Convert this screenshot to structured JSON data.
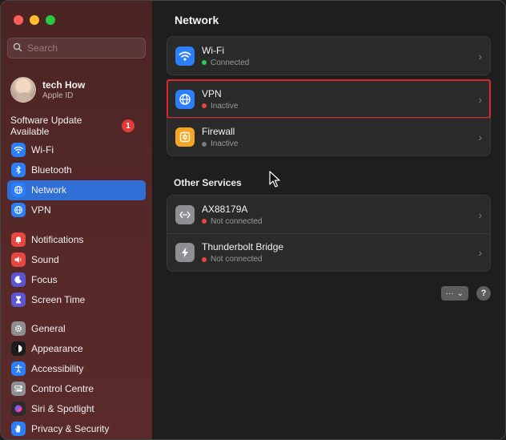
{
  "sidebar": {
    "search": {
      "placeholder": "Search"
    },
    "profile": {
      "name": "tech How",
      "subtitle": "Apple ID"
    },
    "update": {
      "label": "Software Update Available",
      "count": "1"
    },
    "groups": [
      [
        {
          "label": "Wi-Fi",
          "icon": "wifi-icon",
          "color": "#2d7ff9"
        },
        {
          "label": "Bluetooth",
          "icon": "bluetooth-icon",
          "color": "#2d7ff9"
        },
        {
          "label": "Network",
          "icon": "globe-icon",
          "color": "#2d7ff9",
          "active": true
        },
        {
          "label": "VPN",
          "icon": "globe-icon",
          "color": "#2d7ff9"
        }
      ],
      [
        {
          "label": "Notifications",
          "icon": "bell-icon",
          "color": "#e5483f"
        },
        {
          "label": "Sound",
          "icon": "speaker-icon",
          "color": "#e5483f"
        },
        {
          "label": "Focus",
          "icon": "moon-icon",
          "color": "#5c55d6"
        },
        {
          "label": "Screen Time",
          "icon": "hourglass-icon",
          "color": "#5c55d6"
        }
      ],
      [
        {
          "label": "General",
          "icon": "gear-icon",
          "color": "#8e8e93"
        },
        {
          "label": "Appearance",
          "icon": "appearance-icon",
          "color": "#1c1c1e"
        },
        {
          "label": "Accessibility",
          "icon": "accessibility-icon",
          "color": "#2d7ff9"
        },
        {
          "label": "Control Centre",
          "icon": "control-centre-icon",
          "color": "#8e8e93"
        },
        {
          "label": "Siri & Spotlight",
          "icon": "siri-icon",
          "color": "#2b2b2b"
        },
        {
          "label": "Privacy & Security",
          "icon": "hand-icon",
          "color": "#2d7ff9"
        }
      ]
    ]
  },
  "main": {
    "title": "Network",
    "services": [
      {
        "name": "Wi-Fi",
        "status": "Connected",
        "status_color": "#32c75a",
        "icon": "wifi-icon",
        "icon_color": "#2d7ff9"
      },
      {
        "name": "VPN",
        "status": "Inactive",
        "status_color": "#e5483f",
        "icon": "globe-icon",
        "icon_color": "#2d7ff9",
        "highlighted": true
      },
      {
        "name": "Firewall",
        "status": "Inactive",
        "status_color": "#7a7a7a",
        "icon": "firewall-icon",
        "icon_color": "#f5a623"
      }
    ],
    "other_title": "Other Services",
    "other_services": [
      {
        "name": "AX88179A",
        "status": "Not connected",
        "status_color": "#e5483f",
        "icon": "ethernet-icon",
        "icon_color": "#8e8e93"
      },
      {
        "name": "Thunderbolt Bridge",
        "status": "Not connected",
        "status_color": "#e5483f",
        "icon": "thunderbolt-icon",
        "icon_color": "#8e8e93"
      }
    ],
    "footer": {
      "more_label": "···",
      "help_label": "?"
    }
  },
  "colors": {
    "accent": "#2f6fd6",
    "highlight_border": "#e0252b"
  }
}
